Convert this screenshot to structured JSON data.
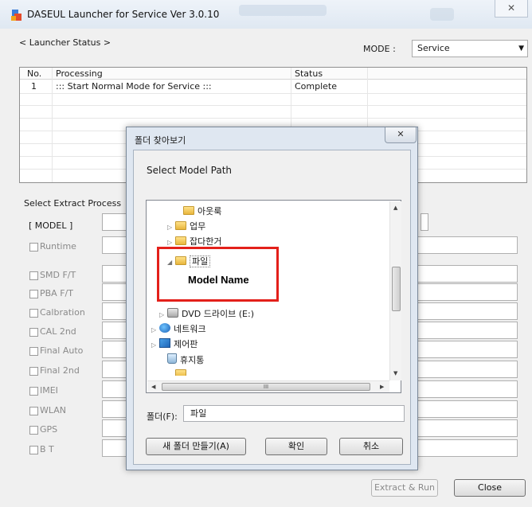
{
  "window": {
    "title": "DASEUL Launcher for Service Ver 3.0.10",
    "close_label": "X"
  },
  "launcher": {
    "section_label": "< Launcher Status >",
    "mode_label": "MODE :",
    "mode_value": "Service",
    "table": {
      "headers": [
        "No.",
        "Processing",
        "Status"
      ],
      "rows": [
        {
          "no": "1",
          "processing": "::: Start Normal Mode for Service :::",
          "status": "Complete"
        }
      ]
    }
  },
  "extract": {
    "group_label": "Select Extract Process",
    "model_label": "[ MODEL ]",
    "options": [
      "Runtime",
      "SMD F/T",
      "PBA F/T",
      "Calbration",
      "CAL 2nd",
      "Final Auto",
      "Final 2nd",
      "IMEI",
      "WLAN",
      "GPS",
      "B T"
    ]
  },
  "buttons": {
    "extract_run": "Extract & Run",
    "close": "Close"
  },
  "dialog": {
    "title": "폴더 찾아보기",
    "close_label": "X",
    "description": "Select Model Path",
    "tree": [
      "아웃룩",
      "업무",
      "잡다한거",
      "파일",
      "DVD 드라이브 (E:)",
      "네트워크",
      "제어판",
      "휴지통"
    ],
    "scroll_grip": "III",
    "folder_label": "폴더(F):",
    "folder_value": "파일",
    "new_folder": "새 폴더 만들기(A)",
    "ok": "확인",
    "cancel": "취소"
  },
  "annotation": {
    "label": "Model Name",
    "color": "#e3201a"
  }
}
